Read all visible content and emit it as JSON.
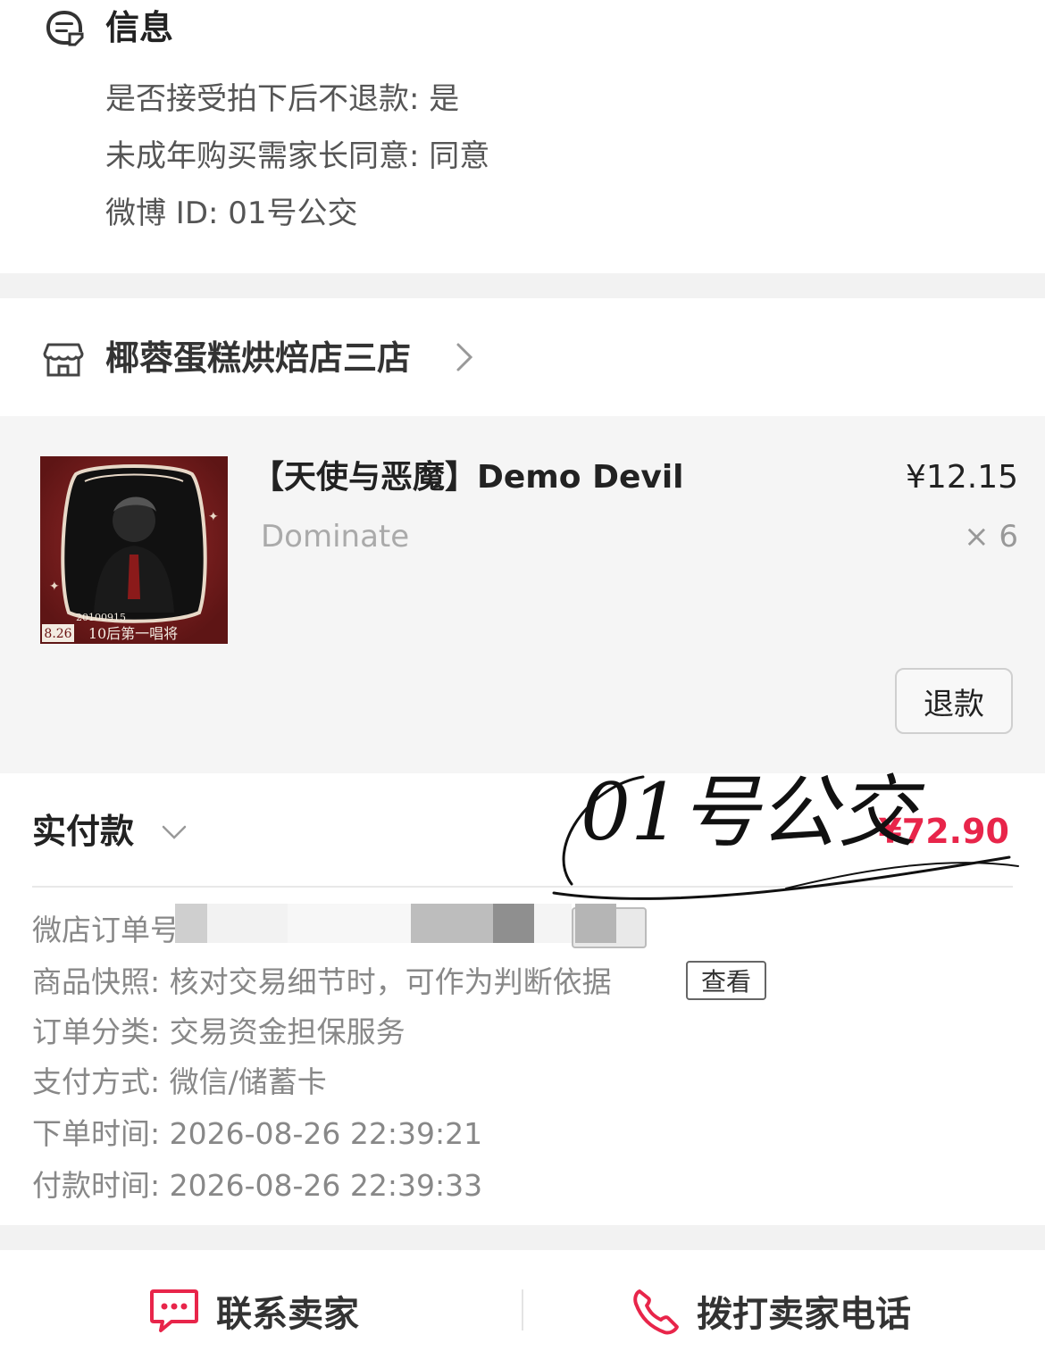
{
  "info": {
    "title": "信息",
    "lines": [
      "是否接受拍下后不退款: 是",
      "未成年购买需家长同意: 同意",
      "微博 ID: 01号公交"
    ]
  },
  "shop": {
    "name": "椰蓉蛋糕烘焙店三店"
  },
  "product": {
    "title": "【天使与恶魔】Demo Devil",
    "sku": "Dominate",
    "price": "¥12.15",
    "quantity": "× 6",
    "thumb_text_date": "20100915",
    "thumb_text_day": "8.26",
    "thumb_text_caption": "10后第一唱将",
    "refund_label": "退款"
  },
  "paid": {
    "label": "实付款",
    "amount": "¥72.90",
    "details": {
      "order_no_label": "微店订单号",
      "snapshot": "商品快照: 核对交易细节时，可作为判断依据",
      "snapshot_button": "查看",
      "category": "订单分类:  交易资金担保服务",
      "payment": "支付方式:  微信/储蓄卡",
      "order_time": "下单时间:  2026-08-26 22:39:21",
      "pay_time": "付款时间:  2026-08-26 22:39:33"
    }
  },
  "watermark": {
    "text": "01号公交"
  },
  "bottom": {
    "contact_label": "联系卖家",
    "call_label": "拨打卖家电话"
  },
  "colors": {
    "accent_red": "#e8254a",
    "background_gray": "#f5f5f5"
  }
}
